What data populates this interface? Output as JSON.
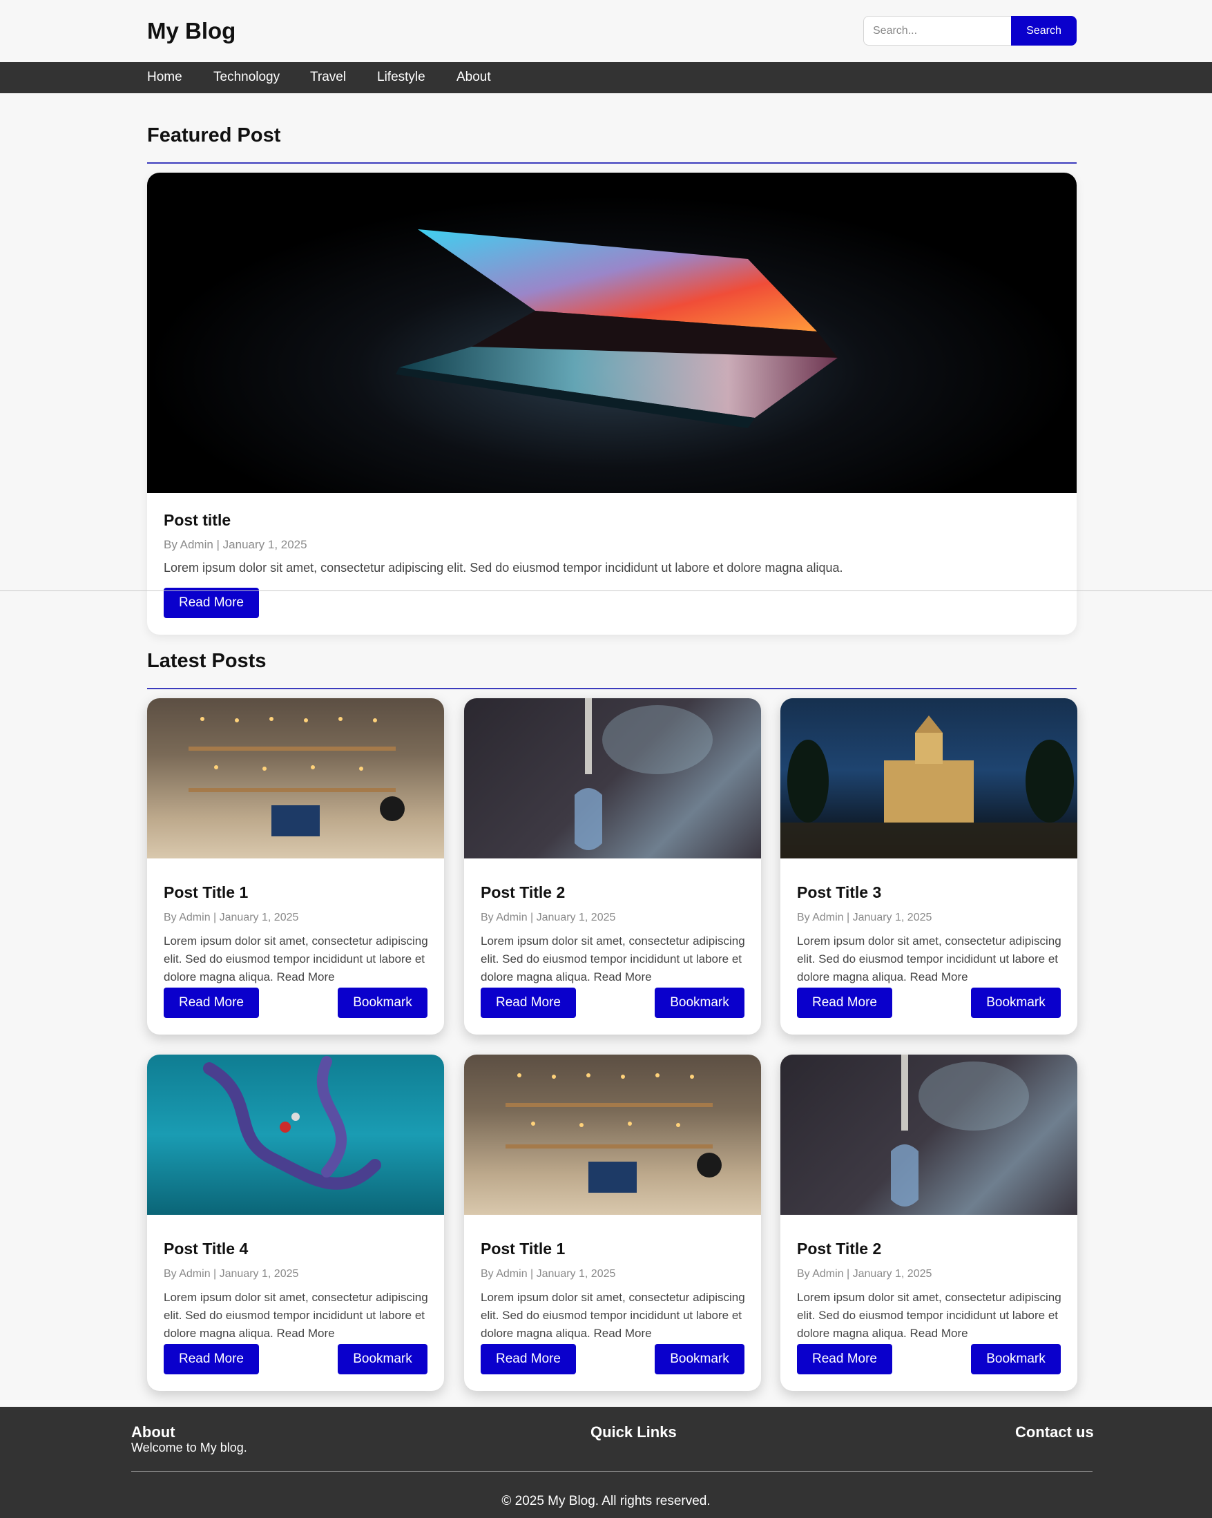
{
  "site": {
    "brand": "My Blog",
    "search_placeholder": "Search...",
    "search_button": "Search"
  },
  "nav": [
    "Home",
    "Technology",
    "Travel",
    "Lifestyle",
    "About"
  ],
  "featured": {
    "section_title": "Featured Post",
    "image": "laptop-half-open-photo",
    "title": "Post title",
    "meta": "By Admin | January 1, 2025",
    "excerpt": "Lorem ipsum dolor sit amet, consectetur adipiscing elit. Sed do eiusmod tempor incididunt ut labore et dolore magna aliqua.",
    "read_more": "Read More"
  },
  "latest": {
    "section_title": "Latest Posts",
    "posts": [
      {
        "image": "shelf-with-lights-photo",
        "title": "Post Title 1",
        "meta": "By Admin | January 1, 2025",
        "excerpt": "Lorem ipsum dolor sit amet, consectetur adipiscing elit. Sed do eiusmod tempor incididunt ut labore et dolore magna aliqua. Read More",
        "read_more": "Read More",
        "bookmark": "Bookmark"
      },
      {
        "image": "dropper-bottle-photo",
        "title": "Post Title 2",
        "meta": "By Admin | January 1, 2025",
        "excerpt": "Lorem ipsum dolor sit amet, consectetur adipiscing elit. Sed do eiusmod tempor incididunt ut labore et dolore magna aliqua. Read More",
        "read_more": "Read More",
        "bookmark": "Bookmark"
      },
      {
        "image": "cathedral-night-photo",
        "title": "Post Title 3",
        "meta": "By Admin | January 1, 2025",
        "excerpt": "Lorem ipsum dolor sit amet, consectetur adipiscing elit. Sed do eiusmod tempor incididunt ut labore et dolore magna aliqua. Read More",
        "read_more": "Read More",
        "bookmark": "Bookmark"
      },
      {
        "image": "protein-structure-photo",
        "title": "Post Title 4",
        "meta": "By Admin | January 1, 2025",
        "excerpt": "Lorem ipsum dolor sit amet, consectetur adipiscing elit. Sed do eiusmod tempor incididunt ut labore et dolore magna aliqua. Read More",
        "read_more": "Read More",
        "bookmark": "Bookmark"
      },
      {
        "image": "shelf-with-lights-photo",
        "title": "Post Title 1",
        "meta": "By Admin | January 1, 2025",
        "excerpt": "Lorem ipsum dolor sit amet, consectetur adipiscing elit. Sed do eiusmod tempor incididunt ut labore et dolore magna aliqua. Read More",
        "read_more": "Read More",
        "bookmark": "Bookmark"
      },
      {
        "image": "dropper-bottle-photo",
        "title": "Post Title 2",
        "meta": "By Admin | January 1, 2025",
        "excerpt": "Lorem ipsum dolor sit amet, consectetur adipiscing elit. Sed do eiusmod tempor incididunt ut labore et dolore magna aliqua. Read More",
        "read_more": "Read More",
        "bookmark": "Bookmark"
      }
    ]
  },
  "footer": {
    "about_title": "About",
    "about_text": "Welcome to My blog.",
    "links_title": "Quick Links",
    "contact_title": "Contact us",
    "copyright": "© 2025 My Blog. All rights reserved."
  },
  "colors": {
    "accent": "#0a00cc",
    "nav_bg": "#333333",
    "section_rule": "#3b3bbd",
    "page_bg": "#f7f7f7"
  }
}
